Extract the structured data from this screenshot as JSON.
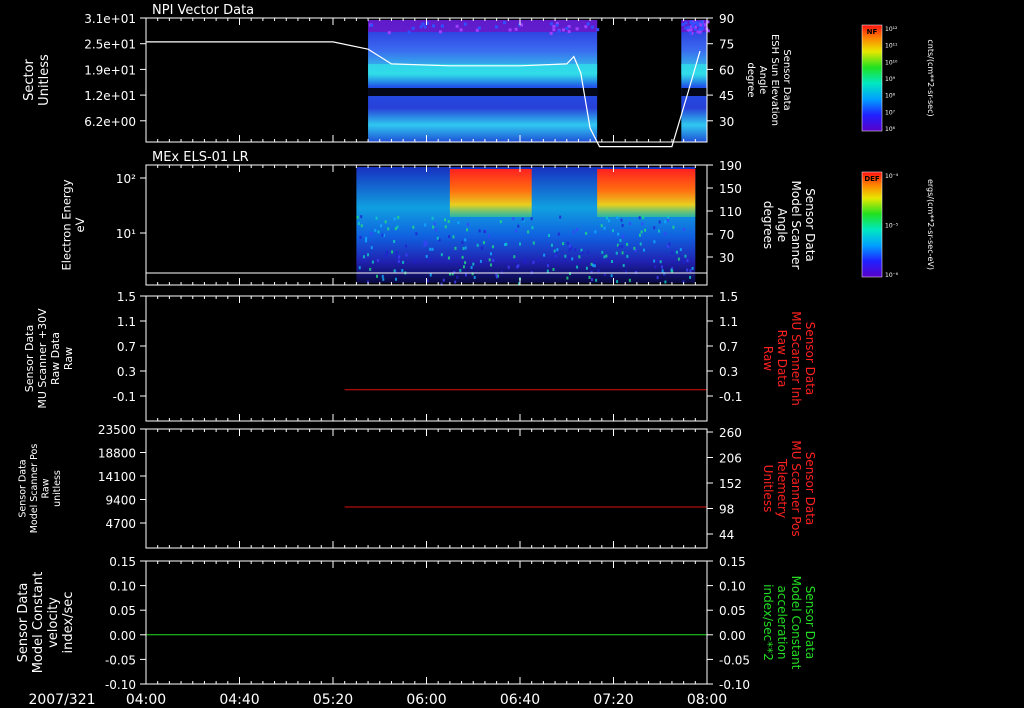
{
  "colors": {
    "background": "#000000",
    "axes": "#ffffff",
    "trace_red": "#dd1111",
    "trace_green": "#22dd22",
    "label_red": "#ff2020",
    "label_green": "#22dd22"
  },
  "footer": {
    "date_label": "2007/321"
  },
  "chart_data": [
    {
      "type": "heatmap",
      "title": "NPI Vector Data",
      "ylabel": [
        "Sector",
        "Unitless"
      ],
      "yticks": [
        "3.1e+01",
        "2.5e+01",
        "1.9e+01",
        "1.2e+01",
        "6.2e+00"
      ],
      "ylabel_right": [
        "Sensor Data",
        "ESH Sun Elevation",
        "Angle",
        "degree"
      ],
      "yticks_right": [
        "90",
        "75",
        "60",
        "45",
        "30"
      ],
      "xticks": [
        "04:00",
        "04:40",
        "05:20",
        "06:00",
        "06:40",
        "07:20",
        "08:00"
      ],
      "data_coverage": [
        [
          "05:35",
          "07:13"
        ],
        [
          "07:49",
          "08:00"
        ]
      ],
      "overlay_line": {
        "name": "ESH Sun Elevation Angle",
        "x": [
          "04:00",
          "05:20",
          "05:35",
          "05:45",
          "06:10",
          "06:40",
          "07:00",
          "07:03",
          "07:06",
          "07:10",
          "07:14",
          "07:30",
          "07:45",
          "07:52",
          "07:57"
        ],
        "y": [
          77,
          77,
          73,
          65,
          64,
          64,
          65,
          69,
          60,
          30,
          20,
          20,
          20,
          50,
          72
        ]
      },
      "colorbar": {
        "label": "NF",
        "unit": "cnts/(cm**2-sr-sec)",
        "ticks": [
          "10¹²",
          "10¹¹",
          "10¹⁰",
          "10⁹",
          "10⁸",
          "10⁷",
          "10⁶"
        ]
      }
    },
    {
      "type": "heatmap",
      "title": "MEx ELS-01 LR",
      "ylabel": [
        "Electron Energy",
        "eV"
      ],
      "yticks": [
        "10²",
        "10¹"
      ],
      "ylabel_right": [
        "Sensor Data",
        "Model Scanner",
        "Angle",
        "degrees"
      ],
      "yticks_right": [
        "190",
        "150",
        "110",
        "70",
        "30"
      ],
      "xticks": [
        "04:00",
        "04:40",
        "05:20",
        "06:00",
        "06:40",
        "07:20",
        "08:00"
      ],
      "data_coverage": [
        [
          "05:30",
          "07:55"
        ]
      ],
      "overlay_line": {
        "name": "Model Scanner Angle",
        "x": [
          "04:00",
          "08:00"
        ],
        "y": [
          2,
          2
        ]
      },
      "colorbar": {
        "label": "DEF",
        "unit": "ergs/(cm**2-sr-sec-eV)",
        "ticks": [
          "10⁻⁴",
          "10⁻⁵",
          "10⁻⁶"
        ]
      }
    },
    {
      "type": "line",
      "ylabel": [
        "Sensor Data",
        "MU Scanner +30V",
        "Raw Data",
        "Raw"
      ],
      "yticks": [
        "1.5",
        "1.1",
        "0.7",
        "0.3",
        "-0.1"
      ],
      "ylabel_right": [
        "Sensor Data",
        "MU Scanner Inh",
        "Raw Data",
        "Raw"
      ],
      "yticks_right": [
        "1.5",
        "1.1",
        "0.7",
        "0.3",
        "-0.1"
      ],
      "ylim": [
        -0.5,
        1.5
      ],
      "xticks": [
        "04:00",
        "04:40",
        "05:20",
        "06:00",
        "06:40",
        "07:20",
        "08:00"
      ],
      "series": [
        {
          "name": "MU Scanner Inh Raw Data",
          "x": [
            "05:25",
            "08:00"
          ],
          "y": [
            0,
            0
          ]
        }
      ]
    },
    {
      "type": "line",
      "ylabel": [
        "Sensor Data",
        "Model Scanner Pos",
        "Raw",
        "unitless"
      ],
      "yticks": [
        "23500",
        "18800",
        "14100",
        "9400",
        "4700"
      ],
      "ylabel_right": [
        "Sensor Data",
        "MU Scanner Pos",
        "Telemetry",
        "Unitless"
      ],
      "yticks_right": [
        "260",
        "206",
        "152",
        "98",
        "44"
      ],
      "ylim": [
        0,
        23500
      ],
      "xticks": [
        "04:00",
        "04:40",
        "05:20",
        "06:00",
        "06:40",
        "07:20",
        "08:00"
      ],
      "series": [
        {
          "name": "MU Scanner Pos Telemetry",
          "x": [
            "05:25",
            "08:00"
          ],
          "y": [
            8100,
            8100
          ]
        }
      ]
    },
    {
      "type": "line",
      "ylabel": [
        "Sensor Data",
        "Model Constant",
        "velocity",
        "index/sec"
      ],
      "yticks": [
        "0.15",
        "0.10",
        "0.05",
        "0.00",
        "-0.05",
        "-0.10"
      ],
      "ylabel_right": [
        "Sensor Data",
        "Model Constant",
        "acceleration",
        "index/sec**2"
      ],
      "yticks_right": [
        "0.15",
        "0.10",
        "0.05",
        "0.00",
        "-0.05",
        "-0.10"
      ],
      "ylim": [
        -0.1,
        0.15
      ],
      "xticks": [
        "04:00",
        "04:40",
        "05:20",
        "06:00",
        "06:40",
        "07:20",
        "08:00"
      ],
      "series": [
        {
          "name": "Model Constant acceleration",
          "x": [
            "04:00",
            "08:00"
          ],
          "y": [
            0,
            0
          ]
        }
      ]
    }
  ]
}
